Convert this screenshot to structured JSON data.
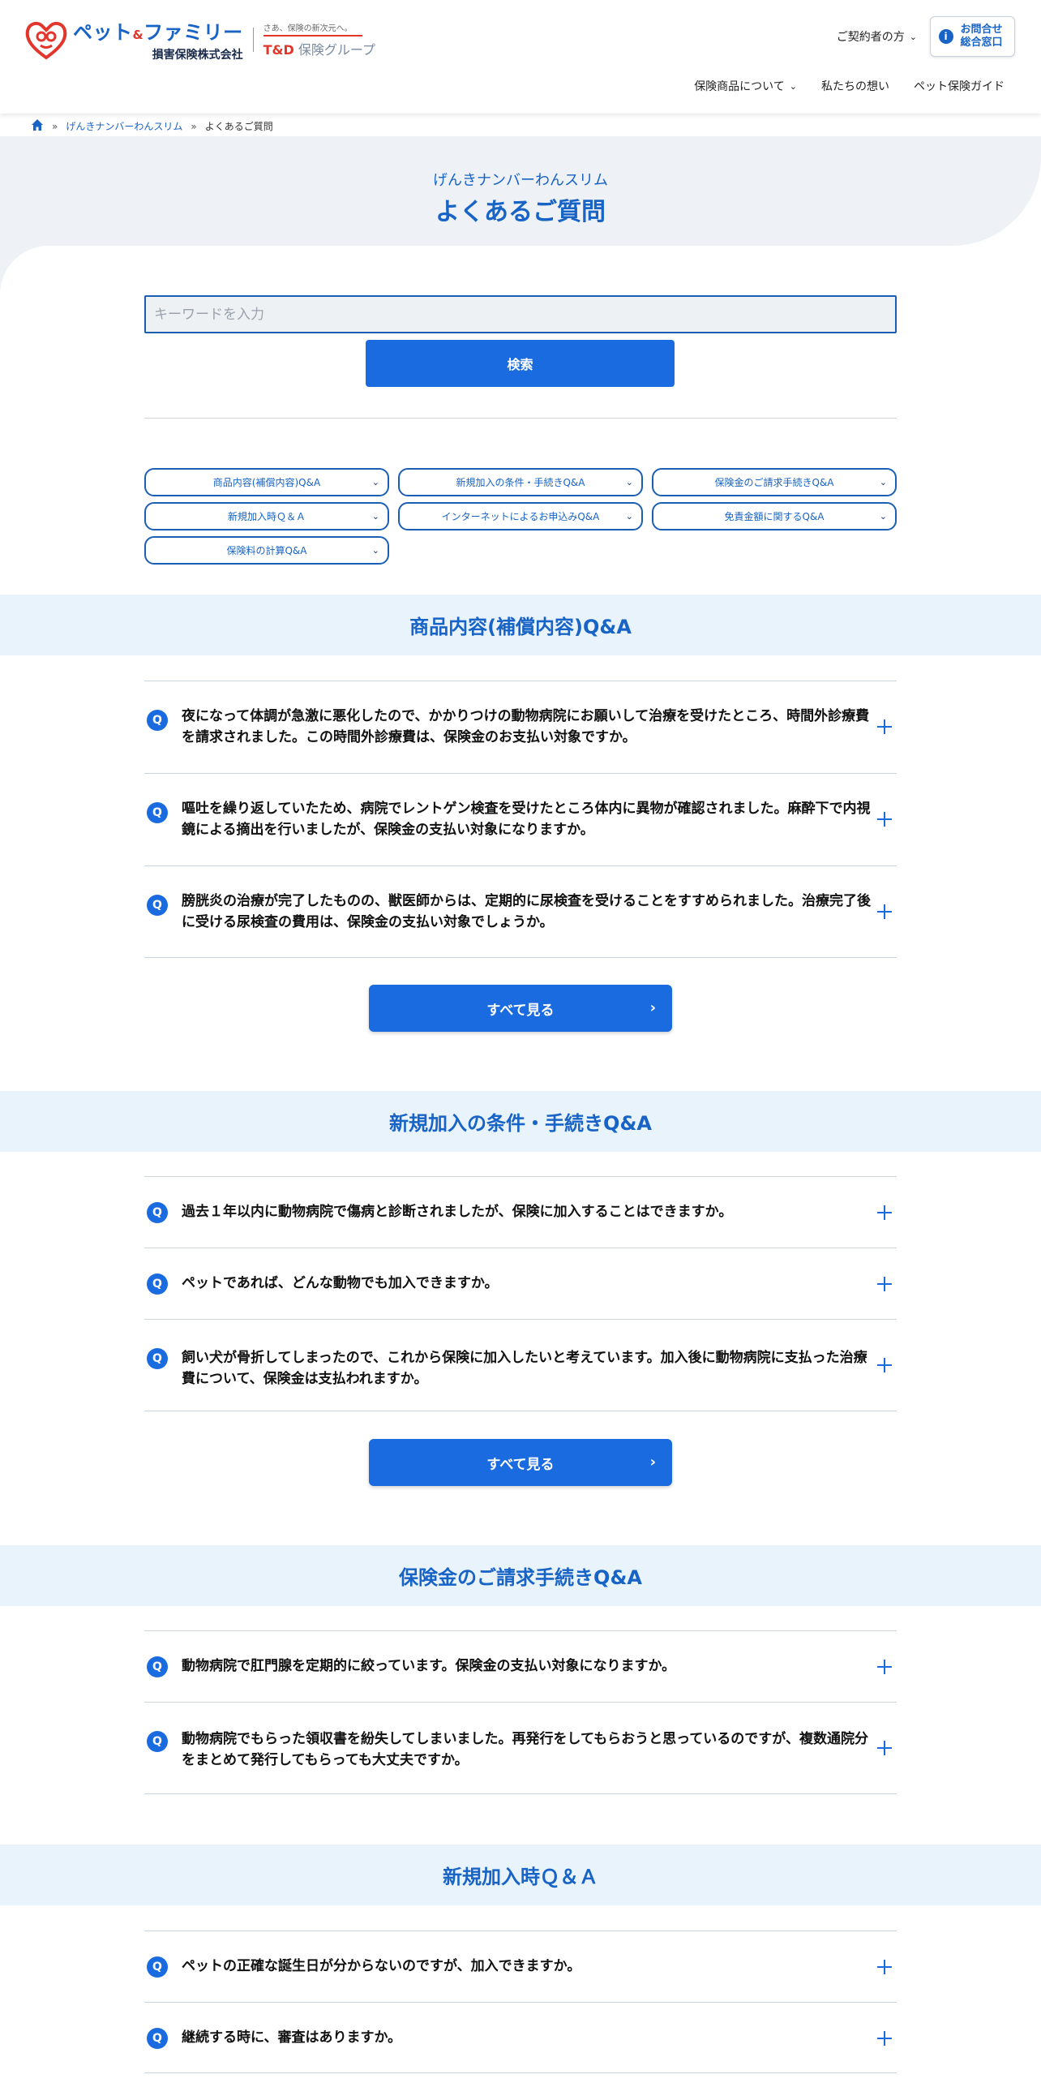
{
  "header": {
    "logo_main": "ペット",
    "logo_amp": "&",
    "logo_main2": "ファミリー",
    "logo_sub": "損害保険株式会社",
    "td_tagline": "さあ、保険の新次元へ。",
    "td_logo_brand": "T&D",
    "td_logo_group": "保険グループ",
    "contractor_link": "ご契約者の方",
    "contact_label": "お問合せ\n総合窓口",
    "contact_line1": "お問合せ",
    "contact_line2": "総合窓口",
    "nav": [
      "保険商品について",
      "私たちの想い",
      "ペット保険ガイド"
    ]
  },
  "breadcrumb": {
    "link": "げんきナンバーわんスリム",
    "current": "よくあるご質問"
  },
  "hero": {
    "subtitle": "げんきナンバーわんスリム",
    "title": "よくあるご質問"
  },
  "search": {
    "placeholder": "キーワードを入力",
    "value": "",
    "button": "検索"
  },
  "categories": [
    "商品内容(補償内容)Q&A",
    "新規加入の条件・手続きQ&A",
    "保険金のご請求手続きQ&A",
    "新規加入時Ｑ＆Ａ",
    "インターネットによるお申込みQ&A",
    "免責金額に関するQ&A",
    "保険料の計算Q&A"
  ],
  "sections": [
    {
      "title": "商品内容(補償内容)Q&A",
      "questions": [
        "夜になって体調が急激に悪化したので、かかりつけの動物病院にお願いして治療を受けたところ、時間外診療費を請求されました。この時間外診療費は、保険金のお支払い対象ですか。",
        "嘔吐を繰り返していたため、病院でレントゲン検査を受けたところ体内に異物が確認されました。麻酔下で内視鏡による摘出を行いましたが、保険金の支払い対象になりますか。",
        "膀胱炎の治療が完了したものの、獣医師からは、定期的に尿検査を受けることをすすめられました。治療完了後に受ける尿検査の費用は、保険金の支払い対象でしょうか。"
      ],
      "all_button": "すべて見る"
    },
    {
      "title": "新規加入の条件・手続きQ&A",
      "questions": [
        "過去１年以内に動物病院で傷病と診断されましたが、保険に加入することはできますか。",
        "ペットであれば、どんな動物でも加入できますか。",
        "飼い犬が骨折してしまったので、これから保険に加入したいと考えています。加入後に動物病院に支払った治療費について、保険金は支払われますか。"
      ],
      "all_button": "すべて見る"
    },
    {
      "title": "保険金のご請求手続きQ&A",
      "questions": [
        "動物病院で肛門腺を定期的に絞っています。保険金の支払い対象になりますか。",
        "動物病院でもらった領収書を紛失してしまいました。再発行をしてもらおうと思っているのですが、複数通院分をまとめて発行してもらっても大丈夫ですか。"
      ]
    },
    {
      "title": "新規加入時Ｑ＆Ａ",
      "questions": [
        "ペットの正確な誕生日が分からないのですが、加入できますか。",
        "継続する時に、審査はありますか。"
      ]
    }
  ],
  "q_label": "Q",
  "colors": {
    "primary": "#1a6be0",
    "title_blue": "#1763c6",
    "band": "#e9f3fc",
    "hero_bg": "#eef1f5",
    "logo_red": "#e2352b"
  },
  "icons": [
    "home-icon",
    "chevron-down-icon",
    "info-icon",
    "q-icon",
    "plus-icon",
    "chevron-right-icon"
  ]
}
